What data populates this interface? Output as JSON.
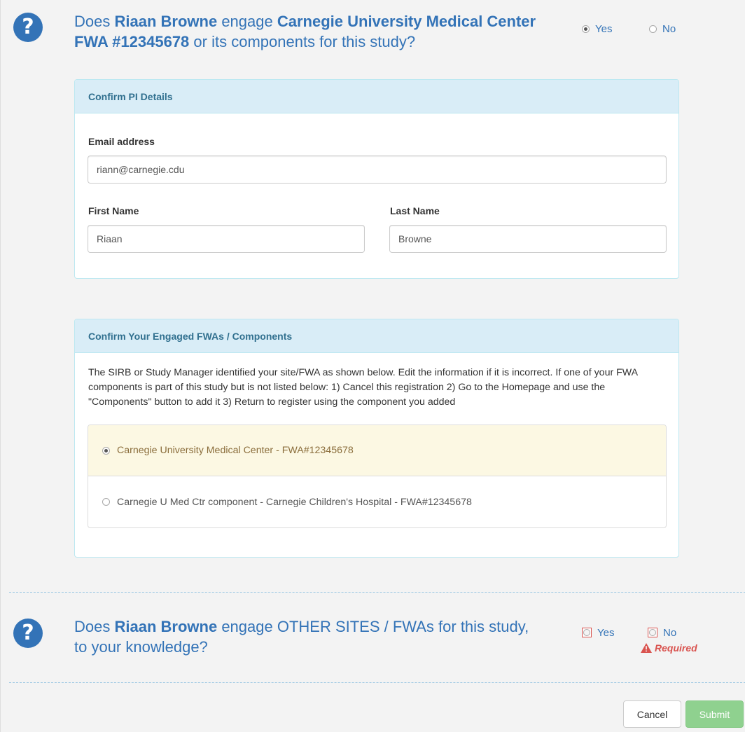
{
  "question1": {
    "prefix": "Does",
    "person": "Riaan Browne",
    "verb": "engage",
    "institution": "Carnegie University Medical Center FWA #12345678",
    "suffix": "or its components for this study?",
    "options": [
      {
        "label": "Yes",
        "selected": true
      },
      {
        "label": "No",
        "selected": false
      }
    ]
  },
  "pi_panel": {
    "title": "Confirm PI Details",
    "email_label": "Email address",
    "email_value": "riann@carnegie.cdu",
    "first_name_label": "First Name",
    "first_name_value": "Riaan",
    "last_name_label": "Last Name",
    "last_name_value": "Browne"
  },
  "fwa_panel": {
    "title": "Confirm Your Engaged FWAs / Components",
    "description": "The SIRB or Study Manager identified your site/FWA as shown below. Edit the information if it is incorrect. If one of your FWA components is part of this study but is not listed below: 1) Cancel this registration 2) Go to the Homepage and use the \"Components\" button to add it 3) Return to register using the component you added",
    "options": [
      {
        "label": "Carnegie University Medical Center - FWA#12345678",
        "selected": true
      },
      {
        "label": "Carnegie U Med Ctr component - Carnegie Children's Hospital - FWA#12345678",
        "selected": false
      }
    ]
  },
  "question2": {
    "prefix": "Does",
    "person": "Riaan Browne",
    "suffix": "engage OTHER SITES / FWAs for this study, to your knowledge?",
    "options": [
      {
        "label": "Yes",
        "selected": false
      },
      {
        "label": "No",
        "selected": false
      }
    ],
    "required_label": "Required"
  },
  "footer": {
    "cancel_label": "Cancel",
    "submit_label": "Submit"
  },
  "colors": {
    "question_blue": "#3373b7",
    "panel_heading_bg": "#d9edf7",
    "selected_row_bg": "#fcf8e3",
    "required_red": "#d9534f",
    "submit_green": "#8fd18f"
  },
  "icons": {
    "question": "question-circle-icon",
    "warning": "warning-triangle-icon"
  }
}
